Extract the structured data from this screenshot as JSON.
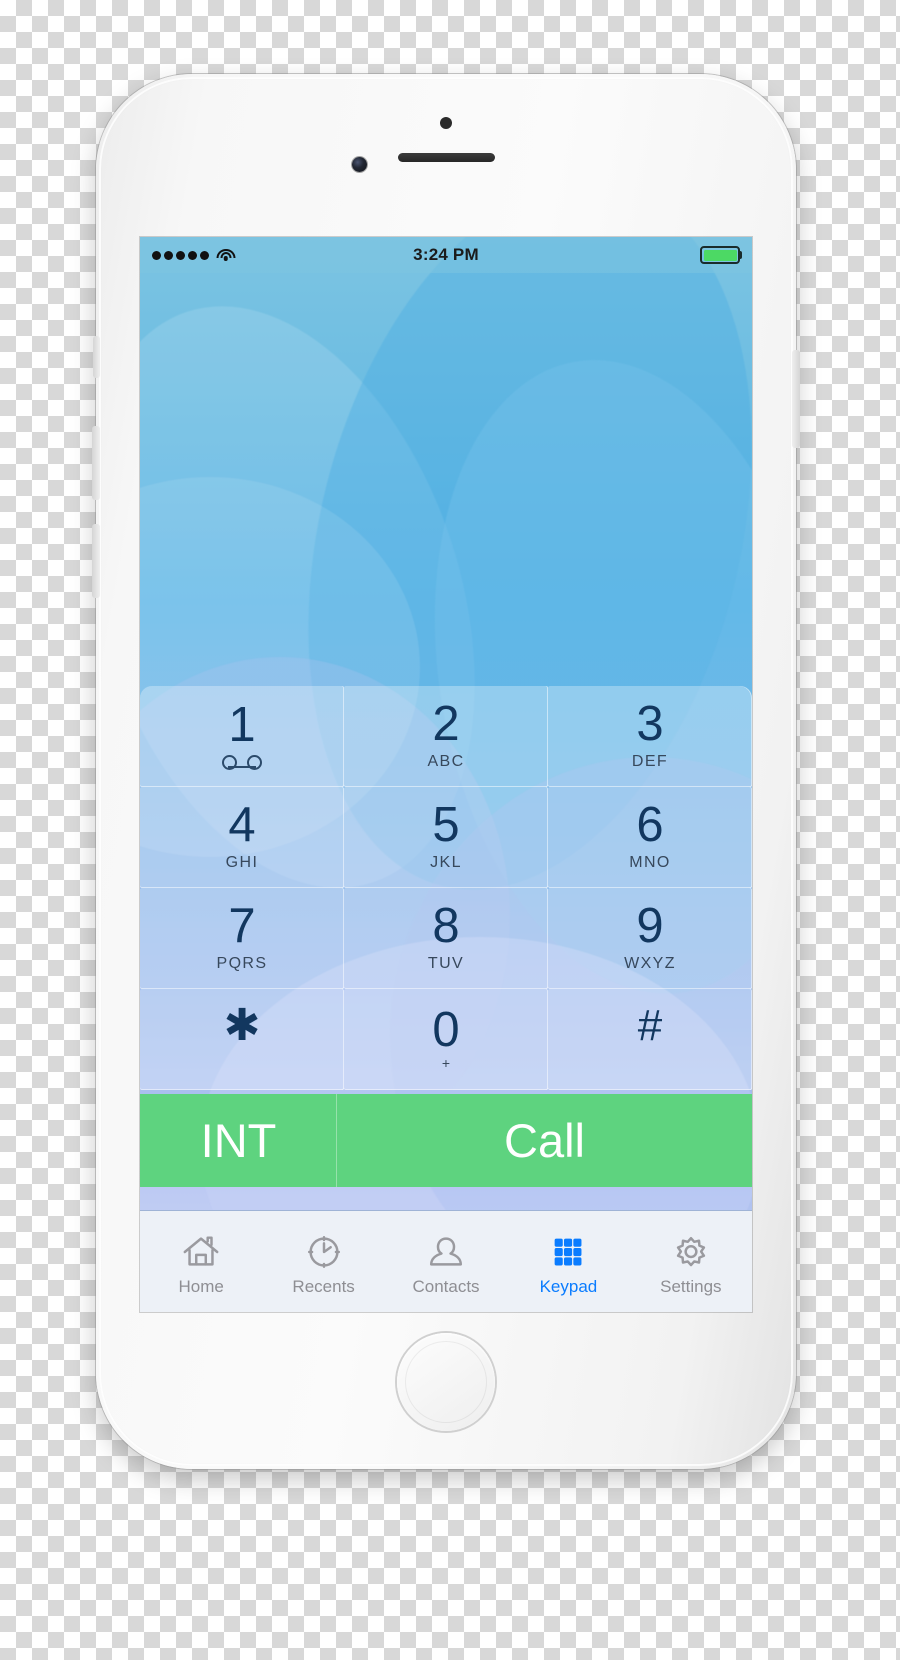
{
  "device": {
    "name": "iphone-white-silver"
  },
  "status_bar": {
    "signal_dots": 5,
    "wifi_icon": "wifi-icon",
    "time": "3:24 PM",
    "battery_icon": "battery-icon",
    "battery_percent": 100,
    "battery_color": "#4cd964"
  },
  "keypad": {
    "rows": [
      [
        {
          "digit": "1",
          "letters": "",
          "icon": "voicemail-icon"
        },
        {
          "digit": "2",
          "letters": "ABC",
          "icon": ""
        },
        {
          "digit": "3",
          "letters": "DEF",
          "icon": ""
        }
      ],
      [
        {
          "digit": "4",
          "letters": "GHI",
          "icon": ""
        },
        {
          "digit": "5",
          "letters": "JKL",
          "icon": ""
        },
        {
          "digit": "6",
          "letters": "MNO",
          "icon": ""
        }
      ],
      [
        {
          "digit": "7",
          "letters": "PQRS",
          "icon": ""
        },
        {
          "digit": "8",
          "letters": "TUV",
          "icon": ""
        },
        {
          "digit": "9",
          "letters": "WXYZ",
          "icon": ""
        }
      ],
      [
        {
          "digit": "✱",
          "letters": "",
          "icon": ""
        },
        {
          "digit": "0",
          "letters": "+",
          "icon": ""
        },
        {
          "digit": "#",
          "letters": "",
          "icon": ""
        }
      ]
    ]
  },
  "actions": {
    "international_label": "INT",
    "call_label": "Call",
    "button_color": "#5ed37f"
  },
  "tabbar": {
    "active_color": "#0a7cff",
    "inactive_color": "#8e8e93",
    "items": [
      {
        "label": "Home",
        "icon": "home-icon",
        "active": false
      },
      {
        "label": "Recents",
        "icon": "clock-icon",
        "active": false
      },
      {
        "label": "Contacts",
        "icon": "person-icon",
        "active": false
      },
      {
        "label": "Keypad",
        "icon": "keypad-icon",
        "active": true
      },
      {
        "label": "Settings",
        "icon": "gear-icon",
        "active": false
      }
    ]
  }
}
